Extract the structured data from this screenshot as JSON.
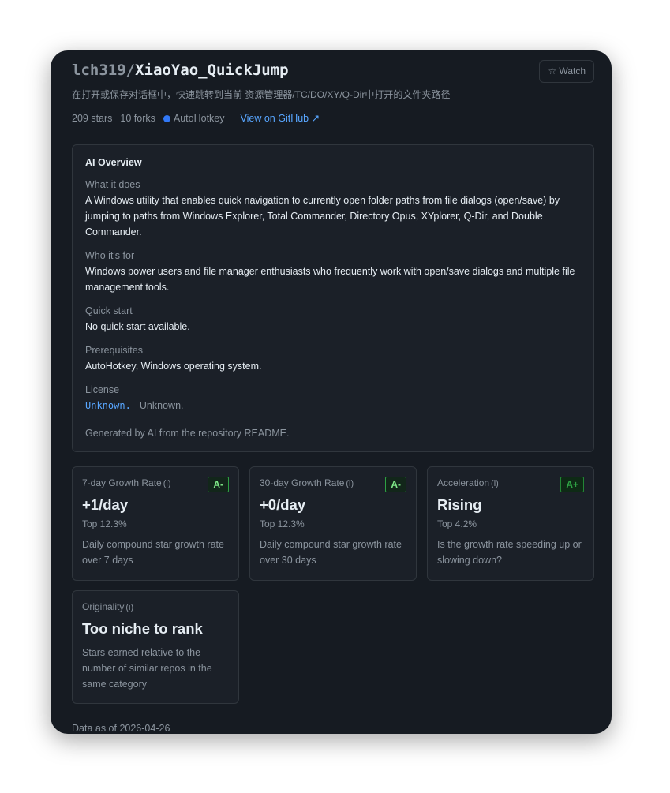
{
  "repo": {
    "owner": "lch319/",
    "name": "XiaoYao_QuickJump",
    "watch_label": "☆ Watch"
  },
  "description": "在打开或保存对话框中，快速跳转到当前 资源管理器/TC/DO/XY/Q-Dir中打开的文件夹路径",
  "meta": {
    "stars": "209 stars",
    "forks": "10 forks",
    "language": "AutoHotkey",
    "language_color": "#3178f6",
    "github_link": "View on GitHub ↗"
  },
  "overview": {
    "title": "AI Overview",
    "what_label": "What it does",
    "what_text": "A Windows utility that enables quick navigation to currently open folder paths from file dialogs (open/save) by jumping to paths from Windows Explorer, Total Commander, Directory Opus, XYplorer, Q-Dir, and Double Commander.",
    "who_label": "Who it's for",
    "who_text": "Windows power users and file manager enthusiasts who frequently work with open/save dialogs and multiple file management tools.",
    "quick_label": "Quick start",
    "quick_text": "No quick start available.",
    "prereq_label": "Prerequisites",
    "prereq_text": "AutoHotkey, Windows operating system.",
    "license_label": "License",
    "license_value": "Unknown.",
    "license_rest": " - Unknown.",
    "generated": "Generated by AI from the repository README."
  },
  "metrics": [
    {
      "label": "7-day Growth Rate",
      "info": "(i)",
      "grade": "A-",
      "value": "+1/day",
      "top": "Top 12.3%",
      "desc": "Daily compound star growth rate over 7 days"
    },
    {
      "label": "30-day Growth Rate",
      "info": "(i)",
      "grade": "A-",
      "value": "+0/day",
      "top": "Top 12.3%",
      "desc": "Daily compound star growth rate over 30 days"
    },
    {
      "label": "Acceleration",
      "info": "(i)",
      "grade": "A+",
      "value": "Rising",
      "top": "Top 4.2%",
      "desc": "Is the growth rate speeding up or slowing down?"
    },
    {
      "label": "Originality",
      "info": "(i)",
      "value": "Too niche to rank",
      "desc": "Stars earned relative to the number of similar repos in the same category"
    }
  ],
  "footer": "Data as of 2026-04-26"
}
